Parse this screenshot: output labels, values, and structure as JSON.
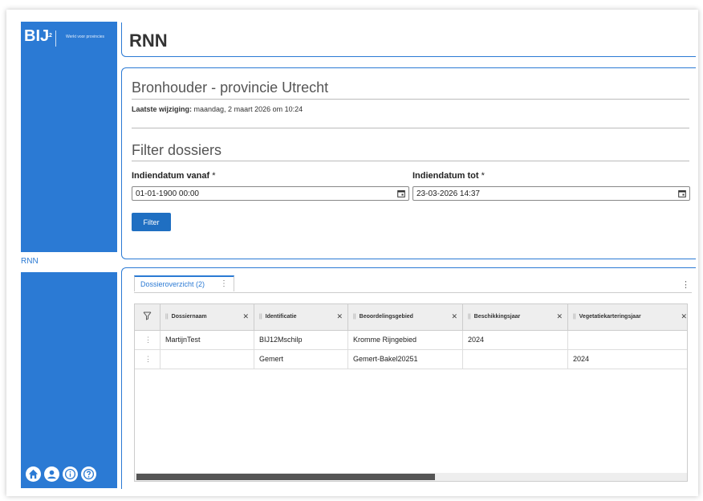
{
  "sidebar": {
    "logo_text": "BIJ",
    "logo_sub": "12",
    "tagline": "Werkt voor provincies",
    "rnn_link": "RNN",
    "icons": [
      "home-icon",
      "user-icon",
      "info-icon",
      "help-icon"
    ]
  },
  "header": {
    "title": "RNN"
  },
  "bronhouder": {
    "title": "Bronhouder - provincie Utrecht",
    "last_modified_label": "Laatste wijziging:",
    "last_modified_value": "maandag, 2 maart 2026 om 10:24"
  },
  "filter": {
    "title": "Filter dossiers",
    "from_label": "Indiendatum vanaf",
    "from_value": "01-01-1900 00:00",
    "to_label": "Indiendatum tot",
    "to_value": "23-03-2026 14:37",
    "required_marker": "*",
    "button_label": "Filter"
  },
  "overview": {
    "tab_label": "Dossieroverzicht (2)",
    "columns": [
      "Dossiernaam",
      "Identificatie",
      "Beoordelingsgebied",
      "Beschikkingsjaar",
      "Vegetatiekarteringsjaar"
    ],
    "rows": [
      [
        "MartijnTest",
        "BIJ12Mschilp",
        "Kromme Rijngebied",
        "2024",
        ""
      ],
      [
        "",
        "Gemert",
        "Gemert-Bakel20251",
        "",
        "2024"
      ]
    ]
  },
  "colors": {
    "accent": "#2b7ad4",
    "button": "#1f6fc2"
  }
}
